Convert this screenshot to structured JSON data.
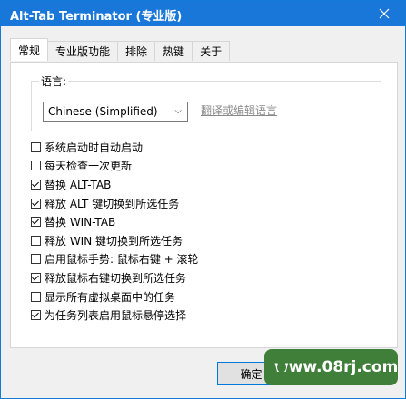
{
  "window": {
    "title": "Alt-Tab Terminator (专业版)"
  },
  "tabs": [
    {
      "label": "常规",
      "active": true
    },
    {
      "label": "专业版功能",
      "active": false
    },
    {
      "label": "排除",
      "active": false
    },
    {
      "label": "热键",
      "active": false
    },
    {
      "label": "关于",
      "active": false
    }
  ],
  "language": {
    "group_label": "语言:",
    "selected": "Chinese (Simplified)",
    "link": "翻译或编辑语言"
  },
  "options": [
    {
      "label": "系统启动时自动启动",
      "checked": false
    },
    {
      "label": "每天检查一次更新",
      "checked": false
    },
    {
      "label": "替换 ALT-TAB",
      "checked": true
    },
    {
      "label": "释放 ALT 键切换到所选任务",
      "checked": true
    },
    {
      "label": "替换 WIN-TAB",
      "checked": true
    },
    {
      "label": "释放 WIN 键切换到所选任务",
      "checked": false
    },
    {
      "label": "启用鼠标手势: 鼠标右键 + 滚轮",
      "checked": false
    },
    {
      "label": "释放鼠标右键切换到所选任务",
      "checked": true
    },
    {
      "label": "显示所有虚拟桌面中的任务",
      "checked": false
    },
    {
      "label": "为任务列表启用鼠标悬停选择",
      "checked": true
    }
  ],
  "ok_button": "确定",
  "watermark": "www.08rj.com"
}
